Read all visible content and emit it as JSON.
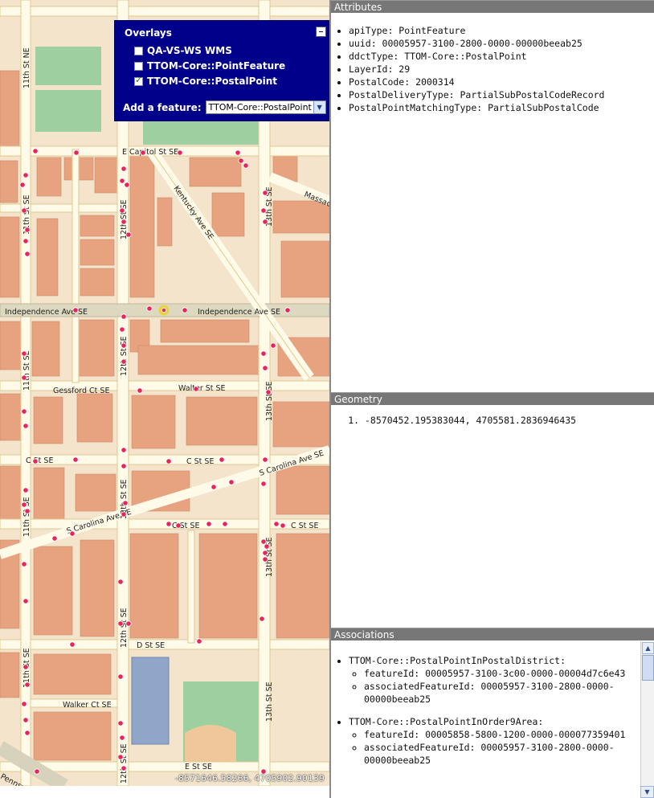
{
  "map": {
    "overlays": {
      "title": "Overlays",
      "layers": [
        {
          "label": "QA-VS-WS WMS",
          "checked": false
        },
        {
          "label": "TTOM-Core::PointFeature",
          "checked": false
        },
        {
          "label": "TTOM-Core::PostalPoint",
          "checked": true
        }
      ],
      "add_feature_label": "Add a feature:",
      "add_feature_value": "TTOM-Core::PostalPoint"
    },
    "coords_readout": "-8571646.58266, 4705902.90139",
    "street_labels": {
      "e_capitol": "E Capitol St SE",
      "independence_w": "Independence Ave SE",
      "independence_e": "Independence Ave SE",
      "kentucky": "Kentucky Ave SE",
      "massachusetts": "Massac",
      "gessford": "Gessford Ct SE",
      "walter": "Walter St SE",
      "c_st_1": "C St SE",
      "c_st_2": "C St SE",
      "c_st_3": "C St SE",
      "c_st_4": "C St SE",
      "s_carolina_e": "S Carolina Ave SE",
      "s_carolina_w": "S Carolina Ave SE",
      "d_st": "D St SE",
      "walker": "Walker Ct SE",
      "e_st": "E St SE",
      "pennsylvania": "Pennsylv",
      "eleventh_ne": "11th St NE",
      "eleventh_se_1": "11th St SE",
      "eleventh_se_2": "11th St SE",
      "eleventh_se_3": "11th St SE",
      "eleventh_se_4": "11th St SE",
      "eleventh_se_5": "11th St SE",
      "twelfth_1": "12th St SE",
      "twelfth_2": "12th St SE",
      "twelfth_3": "12th St SE",
      "twelfth_4": "12th St SE",
      "twelfth_5": "12th St SE",
      "thirteenth_1": "13th St SE",
      "thirteenth_2": "13th St SE",
      "thirteenth_3": "13th St SE",
      "thirteenth_4": "13th St SE"
    }
  },
  "attributes": {
    "header": "Attributes",
    "items": [
      "apiType: PointFeature",
      "uuid: 00005957-3100-2800-0000-00000beeab25",
      "ddctType: TTOM-Core::PostalPoint",
      "LayerId: 29",
      "PostalCode: 2000314",
      "PostalDeliveryType: PartialSubPostalCodeRecord",
      "PostalPointMatchingType: PartialSubPostalCode"
    ]
  },
  "geometry": {
    "header": "Geometry",
    "items": [
      "-8570452.195383044, 4705581.2836946435"
    ]
  },
  "associations": {
    "header": "Associations",
    "groups": [
      {
        "title": "TTOM-Core::PostalPointInPostalDistrict:",
        "feature_id": "featureId: 00005957-3100-3c00-0000-00004d7c6e43",
        "associated_id": "associatedFeatureId: 00005957-3100-2800-0000-00000beeab25"
      },
      {
        "title": "TTOM-Core::PostalPointInOrder9Area:",
        "feature_id": "featureId: 00005858-5800-1200-0000-000077359401",
        "associated_id": "associatedFeatureId: 00005957-3100-2800-0000-00000beeab25"
      }
    ]
  },
  "colors": {
    "overlay_bg": "#00008b",
    "panel_header": "#777777",
    "block_fill": "#f4e4cc",
    "building": "#e7a37f",
    "point": "#e8245c",
    "selected_point": "#f0d020",
    "park": "#9ecfa0"
  }
}
